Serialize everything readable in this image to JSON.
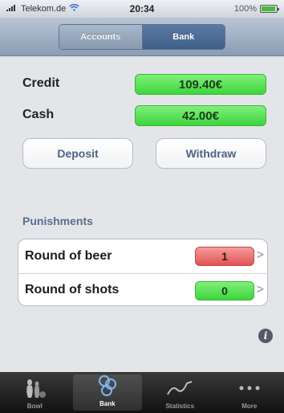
{
  "status_bar": {
    "carrier": "Telekom.de",
    "time": "20:34",
    "battery": "100%"
  },
  "nav": {
    "segments": [
      "Accounts",
      "Bank"
    ],
    "selected": "Bank"
  },
  "balances": {
    "credit_label": "Credit",
    "credit_value": "109.40€",
    "cash_label": "Cash",
    "cash_value": "42.00€"
  },
  "actions": {
    "deposit_label": "Deposit",
    "withdraw_label": "Withdraw"
  },
  "punishments": {
    "header": "Punishments",
    "items": [
      {
        "label": "Round of beer",
        "count": "1",
        "color": "#e05353"
      },
      {
        "label": "Round of shots",
        "count": "0",
        "color": "#3fd43c"
      }
    ]
  },
  "tab_bar": {
    "tabs": [
      {
        "label": "Bowl",
        "icon": "bowling-pins-icon"
      },
      {
        "label": "Bank",
        "icon": "coins-icon"
      },
      {
        "label": "Statistics",
        "icon": "line-graph-icon"
      },
      {
        "label": "More",
        "icon": "more-dots-icon"
      }
    ],
    "selected": "Bank"
  }
}
